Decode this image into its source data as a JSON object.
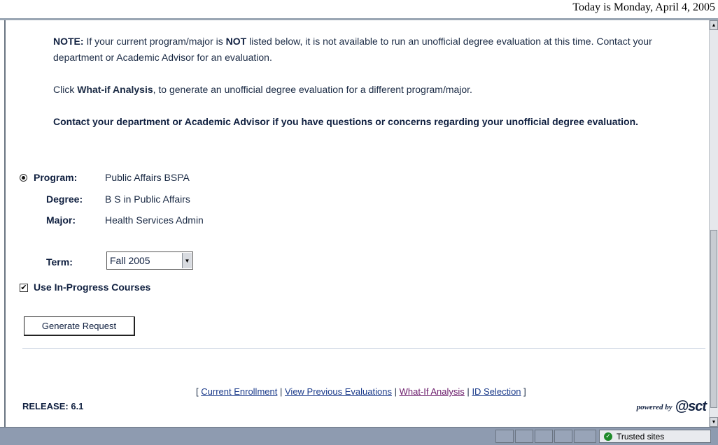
{
  "header": {
    "date_text": "Today is Monday, April 4, 2005"
  },
  "notes": {
    "note_label": "NOTE:",
    "note_text_1": "If your current program/major is",
    "note_not": "NOT",
    "note_text_2": "listed below, it is not available to run an unofficial degree evaluation at this time. Contact your department or Academic Advisor for an evaluation.",
    "click_text": "Click",
    "whatif_label": "What-if Analysis",
    "click_text_2": ", to generate an unofficial degree evaluation for a different program/major.",
    "contact_text": "Contact your department or Academic Advisor if you have questions or concerns regarding your unofficial degree evaluation."
  },
  "curriculum": {
    "program_label": "Program:",
    "program_value": "Public Affairs BSPA",
    "degree_label": "Degree:",
    "degree_value": "B S in Public Affairs",
    "major_label": "Major:",
    "major_value": "Health Services Admin"
  },
  "term": {
    "label": "Term:",
    "selected": "Fall 2005"
  },
  "in_progress": {
    "label": "Use In-Progress Courses",
    "checked": true
  },
  "generate_button": "Generate Request",
  "footer": {
    "open_bracket": "[",
    "close_bracket": "]",
    "separator": "|",
    "links": [
      "Current Enrollment",
      "View Previous Evaluations",
      "What-If Analysis",
      "ID Selection"
    ],
    "release": "RELEASE: 6.1",
    "powered_by": "powered by",
    "logo": "@sct"
  },
  "statusbar": {
    "zone": "Trusted sites"
  }
}
